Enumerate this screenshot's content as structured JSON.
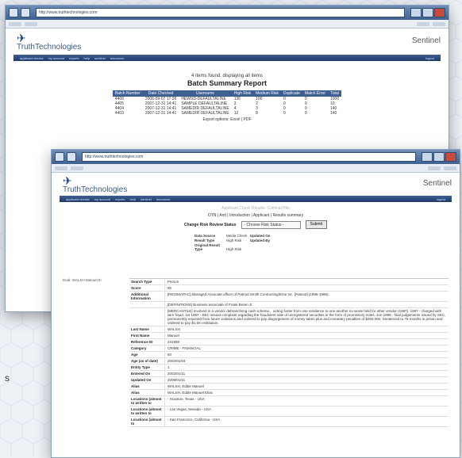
{
  "colors": {
    "accent": "#3f5f93",
    "titlebar": "#4e6fa0",
    "background": "#eef2f7"
  },
  "brand": {
    "logo_text": "TruthTechnologies",
    "product": "Sentinel"
  },
  "window1": {
    "url": "http://www.truthtechnologies.com",
    "nav": [
      "applicant checks",
      "my account",
      "reports",
      "help",
      "sentinel",
      "resources"
    ],
    "nav_right": "logout",
    "report_sub": "4 items found, displaying all items",
    "report_title": "Batch Summary Report",
    "table": {
      "headers": [
        "Batch Number",
        "Date Checked",
        "Username",
        "High Risk",
        "Medium Risk",
        "Duplicate",
        "Match Error",
        "Total"
      ],
      "rows": [
        [
          "4406",
          "2006-09-07 17:26",
          "HEWSD-DEFAULTALINE",
          "136",
          "100",
          "0",
          "0",
          "1000"
        ],
        [
          "4405",
          "2007-12-31 14:41",
          "SAMPLE DEFAULTALINE",
          "3",
          "2",
          "0",
          "0",
          "10"
        ],
        [
          "4404",
          "2007-12-31 14:41",
          "SAMEDIR DEFAULTALINE",
          "4",
          "3",
          "0",
          "0",
          "140"
        ],
        [
          "4403",
          "2007-12-31 14:41",
          "SAMEDIR DEFAULTALINE",
          "12",
          "8",
          "0",
          "0",
          "140"
        ]
      ]
    },
    "export": "Export options: Excel | PDF"
  },
  "window2": {
    "url": "http://www.truthtechnologies.com",
    "nav": [
      "applicant checks",
      "my account",
      "reports",
      "help",
      "sentinel",
      "resources"
    ],
    "nav_right": "logout",
    "caption": "Applicant Check Results: Criminal Hits",
    "links": "OTN | Anti | Introduction | Applicant | Results summary",
    "status_label": "Change Risk Review Status",
    "select_value": "- Choose Risk Status -",
    "submit": "Submit",
    "meta": [
      [
        "Data Source",
        "Media Check",
        "Updated On"
      ],
      [
        "Result Type",
        "High Risk",
        "Updated By"
      ],
      [
        "Original Result Type",
        "High Risk",
        ""
      ]
    ],
    "record_label": "Deal: WALSH Manuel III",
    "rows": [
      [
        "Search Type",
        "Person"
      ],
      [
        "Score",
        "90"
      ],
      [
        "Additional Information",
        "[REGIMAPAC] Managed Assocate officer of Patnod Smith Contructing/Eme Inc. [Patnod] (1998-1998)."
      ],
      [
        "",
        "[DEFINITIONS] Business associate of Frank Brenn Jr."
      ],
      [
        "",
        "[MERCANTILE] Involved in a vendor debranchimg cash scheme... acting foster from one residence to one another no wrote held for other vendor (1987). 1987 - charged with wire fraud. 1st 1987 - SEC issued complaint regarding the fraudulent sale of unregistered securities in the form of promissory notes. Jun 1988 - final judgements issued by SEC, permanently enjoined from future violations and ordered to pay disgorgement of money taken plus and monetary penalties of $250,000. Sentenced to 78 months in prison and ordered to pay $1.5m restitution."
      ],
      [
        "Last Name",
        "WALSH"
      ],
      [
        "First Name",
        "Manuel"
      ],
      [
        "Reference ID",
        "241688"
      ],
      [
        "Category",
        "CRIME - FINANCIAL"
      ],
      [
        "Age",
        "60"
      ],
      [
        "Age (as of date)",
        "2002/01/04"
      ],
      [
        "Entity Type",
        "1"
      ],
      [
        "Entered On",
        "2002/01/11"
      ],
      [
        "Updated On",
        "2008/01/11"
      ],
      [
        "Alias",
        "WALSH, Eddie Manuel"
      ],
      [
        "Alias",
        "WALSH, Eddie Manuel Elias"
      ],
      [
        "Locations (almost to written to",
        "- Houston, Texas - USA"
      ],
      [
        "Locations (almost to written to",
        "- Las Vegas, Nevada - USA"
      ],
      [
        "Locations (almost to",
        "- San Francisco, California - USA"
      ]
    ]
  },
  "stray_text": "s"
}
